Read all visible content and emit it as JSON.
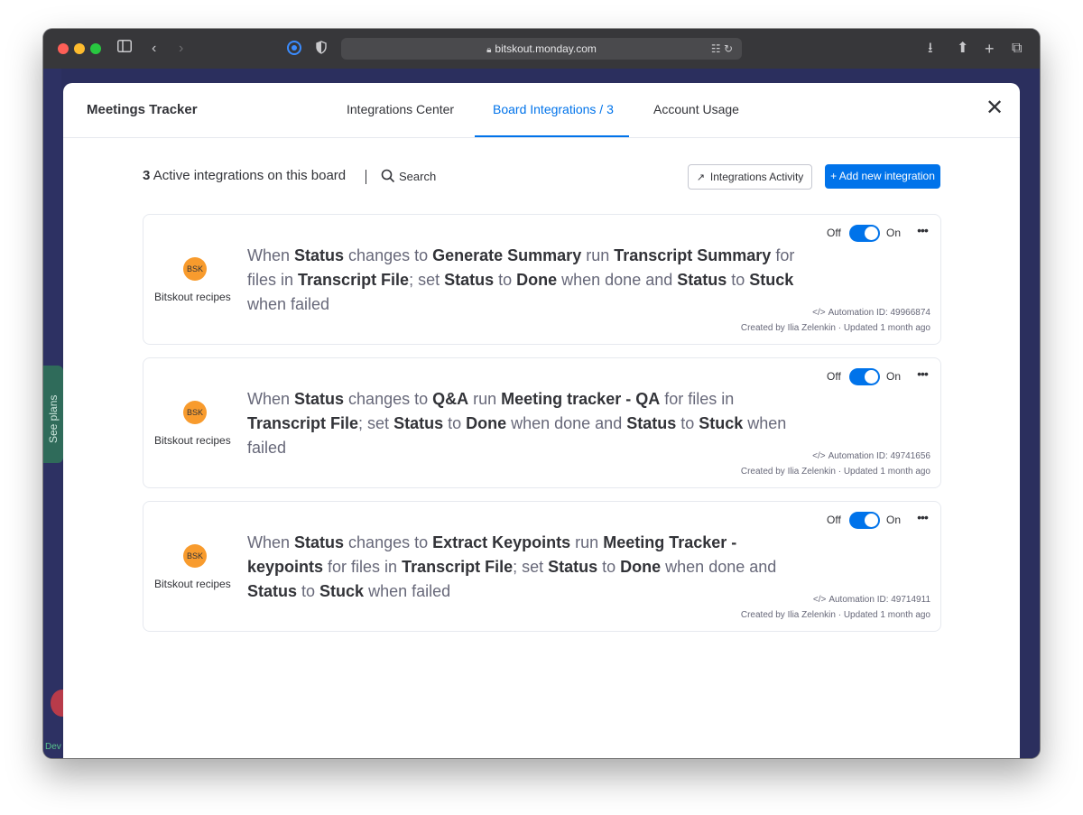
{
  "browser": {
    "url": "bitskout.monday.com",
    "icons": {
      "sidebar": "sidebar-icon",
      "back": "chevron-left-icon",
      "forward": "chevron-right-icon",
      "shield": "shield-icon",
      "translate": "translate-icon",
      "reload": "reload-icon",
      "download": "download-icon",
      "share": "share-icon",
      "new_tab": "plus-icon",
      "tabs": "tabs-overview-icon"
    }
  },
  "background_app": {
    "see_plans_label": "See plans",
    "dev_label": "Dev"
  },
  "modal": {
    "title": "Meetings Tracker",
    "tabs": [
      {
        "label": "Integrations Center",
        "active": false
      },
      {
        "label": "Board Integrations / 3",
        "active": true
      },
      {
        "label": "Account Usage",
        "active": false
      }
    ],
    "summary": {
      "count": "3",
      "text": "Active integrations on this board"
    },
    "search_label": "Search",
    "activity_button": "Integrations Activity",
    "add_button": "+ Add new integration",
    "colors": {
      "accent": "#0073ea",
      "logo": "#f89b2d"
    }
  },
  "integrations": [
    {
      "logo": "BSK",
      "source": "Bitskout recipes",
      "sentence": [
        {
          "t": "When ",
          "b": false
        },
        {
          "t": "Status",
          "b": true
        },
        {
          "t": " changes to ",
          "b": false
        },
        {
          "t": "Generate Summary",
          "b": true
        },
        {
          "t": " run ",
          "b": false
        },
        {
          "t": "Transcript Summary",
          "b": true
        },
        {
          "t": " for files in ",
          "b": false
        },
        {
          "t": "Transcript File",
          "b": true
        },
        {
          "t": "; set ",
          "b": false
        },
        {
          "t": "Status",
          "b": true
        },
        {
          "t": " to ",
          "b": false
        },
        {
          "t": "Done",
          "b": true
        },
        {
          "t": " when done and ",
          "b": false
        },
        {
          "t": "Status",
          "b": true
        },
        {
          "t": " to ",
          "b": false
        },
        {
          "t": "Stuck",
          "b": true
        },
        {
          "t": " when failed",
          "b": false
        }
      ],
      "toggle_off": "Off",
      "toggle_on": "On",
      "enabled": true,
      "automation_id": "Automation ID: 49966874",
      "created": "Created by Ilia Zelenkin · Updated 1 month ago"
    },
    {
      "logo": "BSK",
      "source": "Bitskout recipes",
      "sentence": [
        {
          "t": "When ",
          "b": false
        },
        {
          "t": "Status",
          "b": true
        },
        {
          "t": " changes to ",
          "b": false
        },
        {
          "t": "Q&A",
          "b": true
        },
        {
          "t": " run ",
          "b": false
        },
        {
          "t": "Meeting tracker - QA",
          "b": true
        },
        {
          "t": " for files in ",
          "b": false
        },
        {
          "t": "Transcript File",
          "b": true
        },
        {
          "t": "; set ",
          "b": false
        },
        {
          "t": "Status",
          "b": true
        },
        {
          "t": " to ",
          "b": false
        },
        {
          "t": "Done",
          "b": true
        },
        {
          "t": " when done and ",
          "b": false
        },
        {
          "t": "Status",
          "b": true
        },
        {
          "t": " to ",
          "b": false
        },
        {
          "t": "Stuck",
          "b": true
        },
        {
          "t": " when failed",
          "b": false
        }
      ],
      "toggle_off": "Off",
      "toggle_on": "On",
      "enabled": true,
      "automation_id": "Automation ID: 49741656",
      "created": "Created by Ilia Zelenkin · Updated 1 month ago"
    },
    {
      "logo": "BSK",
      "source": "Bitskout recipes",
      "sentence": [
        {
          "t": "When ",
          "b": false
        },
        {
          "t": "Status",
          "b": true
        },
        {
          "t": " changes to ",
          "b": false
        },
        {
          "t": "Extract Keypoints",
          "b": true
        },
        {
          "t": " run ",
          "b": false
        },
        {
          "t": "Meeting Tracker - keypoints",
          "b": true
        },
        {
          "t": " for files in ",
          "b": false
        },
        {
          "t": "Transcript File",
          "b": true
        },
        {
          "t": "; set ",
          "b": false
        },
        {
          "t": "Status",
          "b": true
        },
        {
          "t": " to ",
          "b": false
        },
        {
          "t": "Done",
          "b": true
        },
        {
          "t": " when done and ",
          "b": false
        },
        {
          "t": "Status",
          "b": true
        },
        {
          "t": " to ",
          "b": false
        },
        {
          "t": "Stuck",
          "b": true
        },
        {
          "t": " when failed",
          "b": false
        }
      ],
      "toggle_off": "Off",
      "toggle_on": "On",
      "enabled": true,
      "automation_id": "Automation ID: 49714911",
      "created": "Created by Ilia Zelenkin · Updated 1 month ago"
    }
  ]
}
